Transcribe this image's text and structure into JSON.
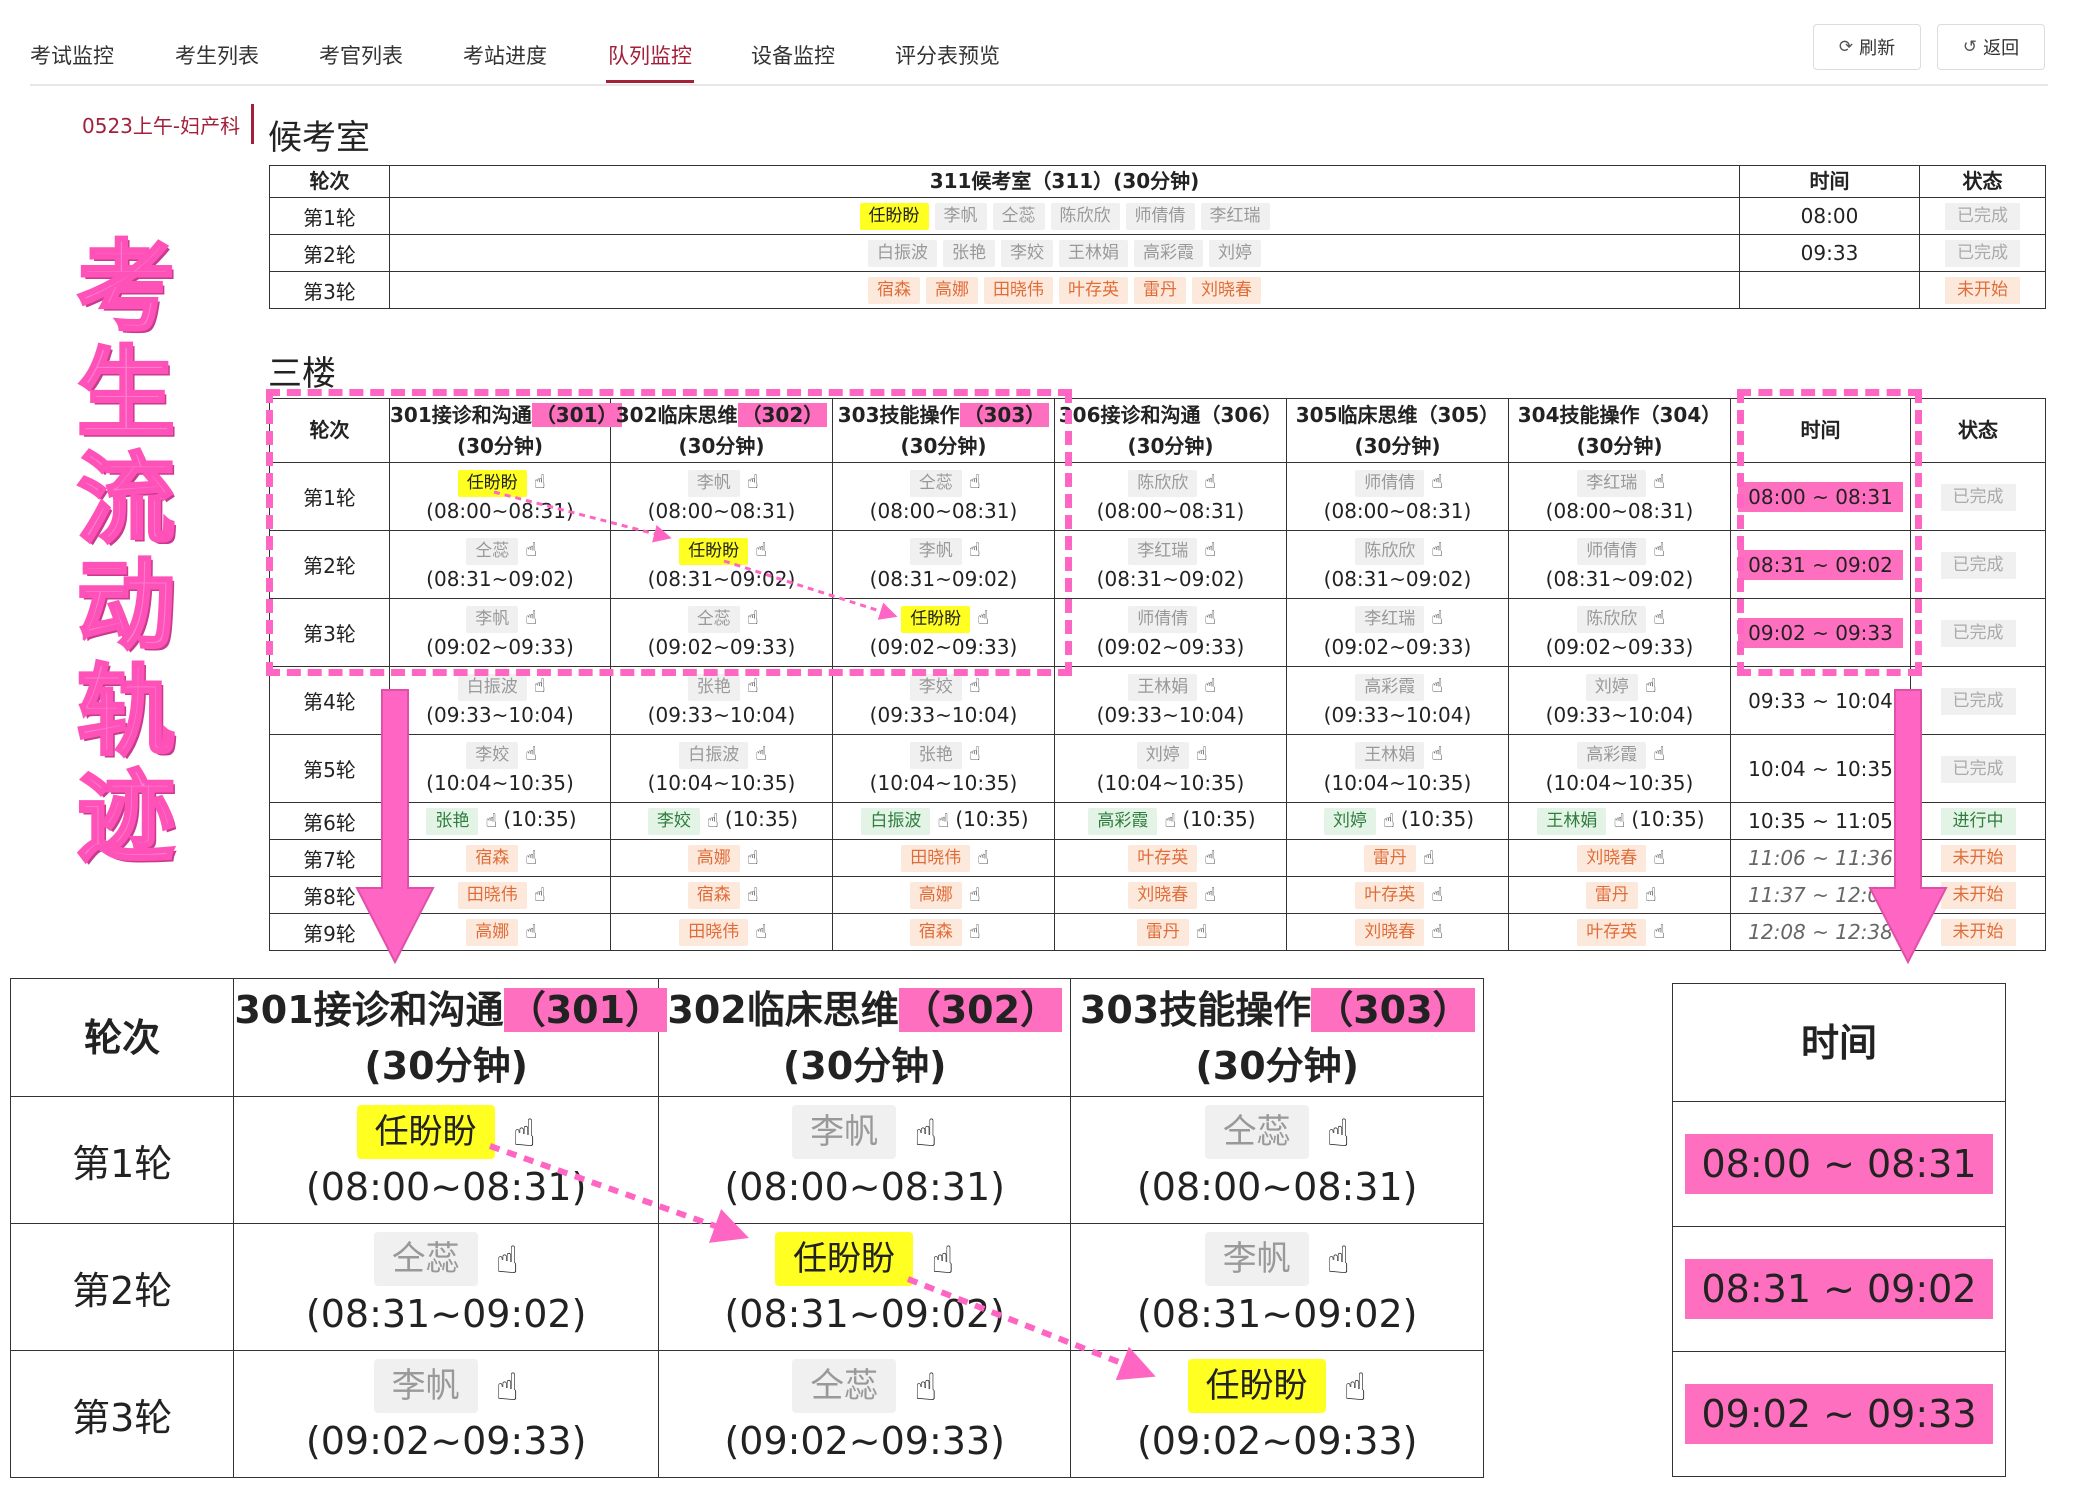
{
  "nav": {
    "tabs": [
      "考试监控",
      "考生列表",
      "考官列表",
      "考站进度",
      "队列监控",
      "设备监控",
      "评分表预览"
    ],
    "active": 4,
    "refresh": "刷新",
    "back": "返回"
  },
  "session_label": "0523上午-妇产科",
  "waiting": {
    "title": "候考室",
    "headers": [
      "轮次",
      "311候考室（311）(30分钟)",
      "时间",
      "状态"
    ],
    "rows": [
      {
        "round": "第1轮",
        "chips": [
          {
            "n": "任盼盼",
            "c": "yel"
          },
          {
            "n": "李帆",
            "c": "gray"
          },
          {
            "n": "仝蕊",
            "c": "gray"
          },
          {
            "n": "陈欣欣",
            "c": "gray"
          },
          {
            "n": "师倩倩",
            "c": "gray"
          },
          {
            "n": "李红瑞",
            "c": "gray"
          }
        ],
        "time": "08:00",
        "status": "已完成",
        "sc": "done"
      },
      {
        "round": "第2轮",
        "chips": [
          {
            "n": "白振波",
            "c": "gray"
          },
          {
            "n": "张艳",
            "c": "gray"
          },
          {
            "n": "李姣",
            "c": "gray"
          },
          {
            "n": "王林娟",
            "c": "gray"
          },
          {
            "n": "高彩霞",
            "c": "gray"
          },
          {
            "n": "刘婷",
            "c": "gray"
          }
        ],
        "time": "09:33",
        "status": "已完成",
        "sc": "done"
      },
      {
        "round": "第3轮",
        "chips": [
          {
            "n": "宿森",
            "c": "org"
          },
          {
            "n": "高娜",
            "c": "org"
          },
          {
            "n": "田晓伟",
            "c": "org"
          },
          {
            "n": "叶存英",
            "c": "org"
          },
          {
            "n": "雷丹",
            "c": "org"
          },
          {
            "n": "刘晓春",
            "c": "org"
          }
        ],
        "time": "",
        "status": "未开始",
        "sc": "todo"
      }
    ]
  },
  "floor": {
    "title": "三楼",
    "round_header": "轮次",
    "time_header": "时间",
    "status_header": "状态",
    "stations": [
      {
        "name": "301接诊和沟通",
        "code": "（301）",
        "dur": "(30分钟)",
        "hl": true
      },
      {
        "name": "302临床思维",
        "code": "（302）",
        "dur": "(30分钟)",
        "hl": true
      },
      {
        "name": "303技能操作",
        "code": "（303）",
        "dur": "(30分钟)",
        "hl": true
      },
      {
        "name": "306接诊和沟通",
        "code": "（306）",
        "dur": "(30分钟)",
        "hl": false
      },
      {
        "name": "305临床思维",
        "code": "（305）",
        "dur": "(30分钟)",
        "hl": false
      },
      {
        "name": "304技能操作",
        "code": "（304）",
        "dur": "(30分钟)",
        "hl": false
      }
    ],
    "rows": [
      {
        "round": "第1轮",
        "tall": true,
        "cells": [
          {
            "n": "任盼盼",
            "c": "yel",
            "t": "(08:00~08:31)"
          },
          {
            "n": "李帆",
            "c": "gray",
            "t": "(08:00~08:31)"
          },
          {
            "n": "仝蕊",
            "c": "gray",
            "t": "(08:00~08:31)"
          },
          {
            "n": "陈欣欣",
            "c": "gray",
            "t": "(08:00~08:31)"
          },
          {
            "n": "师倩倩",
            "c": "gray",
            "t": "(08:00~08:31)"
          },
          {
            "n": "李红瑞",
            "c": "gray",
            "t": "(08:00~08:31)"
          }
        ],
        "time": "08:00 ~ 08:31",
        "tstyle": "pill",
        "status": "已完成",
        "sc": "done"
      },
      {
        "round": "第2轮",
        "tall": true,
        "cells": [
          {
            "n": "仝蕊",
            "c": "gray",
            "t": "(08:31~09:02)"
          },
          {
            "n": "任盼盼",
            "c": "yel",
            "t": "(08:31~09:02)"
          },
          {
            "n": "李帆",
            "c": "gray",
            "t": "(08:31~09:02)"
          },
          {
            "n": "李红瑞",
            "c": "gray",
            "t": "(08:31~09:02)"
          },
          {
            "n": "陈欣欣",
            "c": "gray",
            "t": "(08:31~09:02)"
          },
          {
            "n": "师倩倩",
            "c": "gray",
            "t": "(08:31~09:02)"
          }
        ],
        "time": "08:31 ~ 09:02",
        "tstyle": "pill",
        "status": "已完成",
        "sc": "done"
      },
      {
        "round": "第3轮",
        "tall": true,
        "cells": [
          {
            "n": "李帆",
            "c": "gray",
            "t": "(09:02~09:33)"
          },
          {
            "n": "仝蕊",
            "c": "gray",
            "t": "(09:02~09:33)"
          },
          {
            "n": "任盼盼",
            "c": "yel",
            "t": "(09:02~09:33)"
          },
          {
            "n": "师倩倩",
            "c": "gray",
            "t": "(09:02~09:33)"
          },
          {
            "n": "李红瑞",
            "c": "gray",
            "t": "(09:02~09:33)"
          },
          {
            "n": "陈欣欣",
            "c": "gray",
            "t": "(09:02~09:33)"
          }
        ],
        "time": "09:02 ~ 09:33",
        "tstyle": "pill",
        "status": "已完成",
        "sc": "done"
      },
      {
        "round": "第4轮",
        "tall": true,
        "cells": [
          {
            "n": "白振波",
            "c": "gray",
            "t": "(09:33~10:04)"
          },
          {
            "n": "张艳",
            "c": "gray",
            "t": "(09:33~10:04)"
          },
          {
            "n": "李姣",
            "c": "gray",
            "t": "(09:33~10:04)"
          },
          {
            "n": "王林娟",
            "c": "gray",
            "t": "(09:33~10:04)"
          },
          {
            "n": "高彩霞",
            "c": "gray",
            "t": "(09:33~10:04)"
          },
          {
            "n": "刘婷",
            "c": "gray",
            "t": "(09:33~10:04)"
          }
        ],
        "time": "09:33 ~ 10:04",
        "tstyle": "plain",
        "status": "已完成",
        "sc": "done"
      },
      {
        "round": "第5轮",
        "tall": true,
        "cells": [
          {
            "n": "李姣",
            "c": "gray",
            "t": "(10:04~10:35)"
          },
          {
            "n": "白振波",
            "c": "gray",
            "t": "(10:04~10:35)"
          },
          {
            "n": "张艳",
            "c": "gray",
            "t": "(10:04~10:35)"
          },
          {
            "n": "刘婷",
            "c": "gray",
            "t": "(10:04~10:35)"
          },
          {
            "n": "王林娟",
            "c": "gray",
            "t": "(10:04~10:35)"
          },
          {
            "n": "高彩霞",
            "c": "gray",
            "t": "(10:04~10:35)"
          }
        ],
        "time": "10:04 ~ 10:35",
        "tstyle": "plain",
        "status": "已完成",
        "sc": "done"
      },
      {
        "round": "第6轮",
        "tall": false,
        "cells": [
          {
            "n": "张艳",
            "c": "grn",
            "t": "(10:35)"
          },
          {
            "n": "李姣",
            "c": "grn",
            "t": "(10:35)"
          },
          {
            "n": "白振波",
            "c": "grn",
            "t": "(10:35)"
          },
          {
            "n": "高彩霞",
            "c": "grn",
            "t": "(10:35)"
          },
          {
            "n": "刘婷",
            "c": "grn",
            "t": "(10:35)"
          },
          {
            "n": "王林娟",
            "c": "grn",
            "t": "(10:35)"
          }
        ],
        "time": "10:35 ~ 11:05",
        "tstyle": "plain",
        "status": "进行中",
        "sc": "prog"
      },
      {
        "round": "第7轮",
        "tall": false,
        "cells": [
          {
            "n": "宿森",
            "c": "org",
            "t": ""
          },
          {
            "n": "高娜",
            "c": "org",
            "t": ""
          },
          {
            "n": "田晓伟",
            "c": "org",
            "t": ""
          },
          {
            "n": "叶存英",
            "c": "org",
            "t": ""
          },
          {
            "n": "雷丹",
            "c": "org",
            "t": ""
          },
          {
            "n": "刘晓春",
            "c": "org",
            "t": ""
          }
        ],
        "time": "11:06 ~ 11:36",
        "tstyle": "ital",
        "status": "未开始",
        "sc": "todo"
      },
      {
        "round": "第8轮",
        "tall": false,
        "cells": [
          {
            "n": "田晓伟",
            "c": "org",
            "t": ""
          },
          {
            "n": "宿森",
            "c": "org",
            "t": ""
          },
          {
            "n": "高娜",
            "c": "org",
            "t": ""
          },
          {
            "n": "刘晓春",
            "c": "org",
            "t": ""
          },
          {
            "n": "叶存英",
            "c": "org",
            "t": ""
          },
          {
            "n": "雷丹",
            "c": "org",
            "t": ""
          }
        ],
        "time": "11:37 ~ 12:07",
        "tstyle": "ital",
        "status": "未开始",
        "sc": "todo"
      },
      {
        "round": "第9轮",
        "tall": false,
        "cells": [
          {
            "n": "高娜",
            "c": "org",
            "t": ""
          },
          {
            "n": "田晓伟",
            "c": "org",
            "t": ""
          },
          {
            "n": "宿森",
            "c": "org",
            "t": ""
          },
          {
            "n": "雷丹",
            "c": "org",
            "t": ""
          },
          {
            "n": "刘晓春",
            "c": "org",
            "t": ""
          },
          {
            "n": "叶存英",
            "c": "org",
            "t": ""
          }
        ],
        "time": "12:08 ~ 12:38",
        "tstyle": "ital",
        "status": "未开始",
        "sc": "todo"
      }
    ]
  },
  "side_title": [
    "考",
    "生",
    "流",
    "动",
    "轨",
    "迹"
  ],
  "colors": {
    "accent": "#a3203a",
    "highlight_pink": "#ff6fbf",
    "candidate_yellow": "#ffff22",
    "arrow_pink": "#ff66c4"
  }
}
